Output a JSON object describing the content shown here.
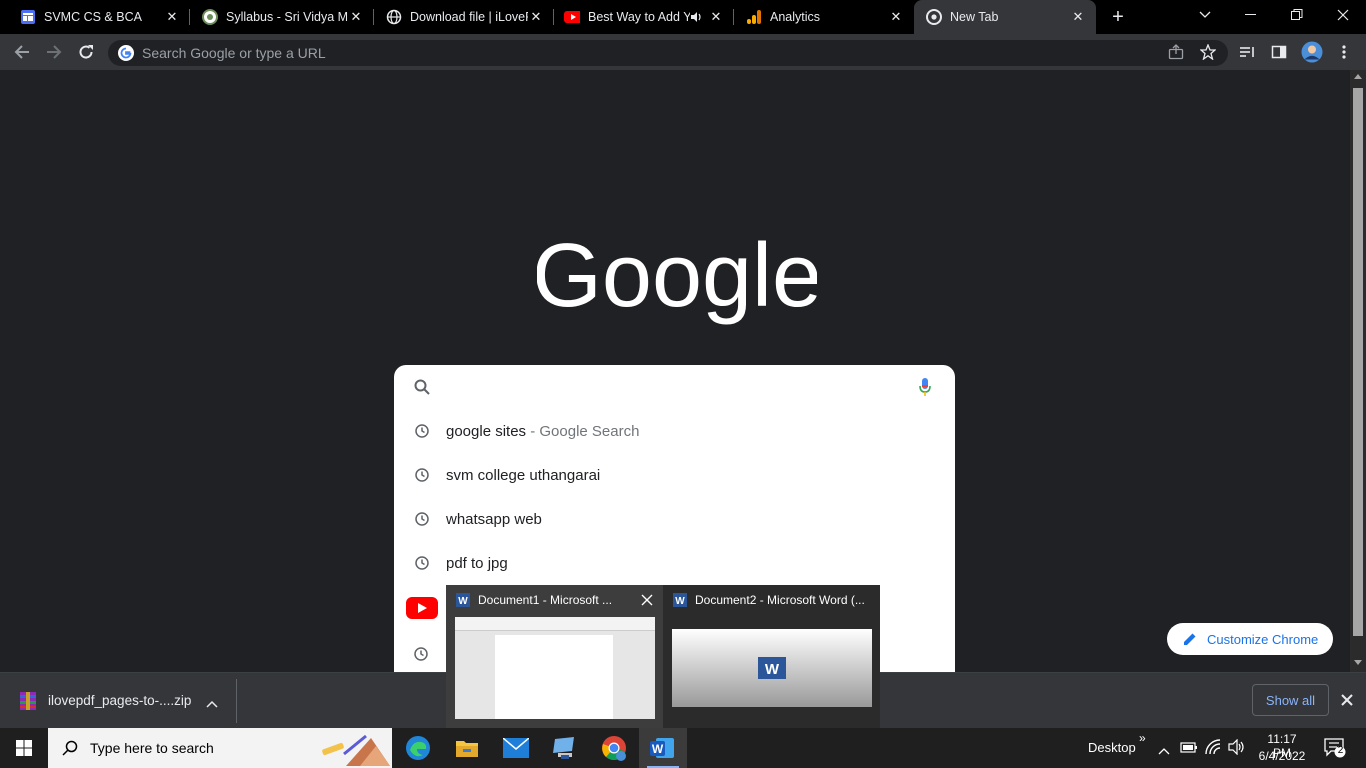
{
  "tabs": [
    {
      "label": "SVMC CS & BCA",
      "icon": "sites-icon"
    },
    {
      "label": "Syllabus - Sri Vidya Mandir",
      "icon": "college-icon"
    },
    {
      "label": "Download file | iLovePDF",
      "icon": "globe-icon"
    },
    {
      "label": "Best Way to Add YouTube",
      "icon": "youtube-icon"
    },
    {
      "label": "Analytics",
      "icon": "analytics-icon"
    },
    {
      "label": "New Tab",
      "icon": "chrome-icon"
    }
  ],
  "omnibox": {
    "placeholder": "Search Google or type a URL"
  },
  "logo_text": "Google",
  "suggestions": [
    {
      "main": "google sites",
      "sub": " - Google Search"
    },
    {
      "main": "svm college uthangarai",
      "sub": ""
    },
    {
      "main": "whatsapp web",
      "sub": ""
    },
    {
      "main": "pdf to jpg",
      "sub": ""
    }
  ],
  "customize_label": "Customize Chrome",
  "thumbnails": [
    {
      "title": "Document1 - Microsoft ..."
    },
    {
      "title": "Document2 - Microsoft Word (..."
    }
  ],
  "download": {
    "filename": "ilovepdf_pages-to-....zip",
    "show_all": "Show all"
  },
  "taskbar": {
    "search_placeholder": "Type here to search",
    "desktop_label": "Desktop",
    "time": "11:17 PM",
    "date": "6/4/2022",
    "notification_count": "2"
  },
  "colors": {
    "tabbar": "#000000",
    "toolbar": "#35363a",
    "page": "#202124",
    "accent": "#1a73e8"
  }
}
